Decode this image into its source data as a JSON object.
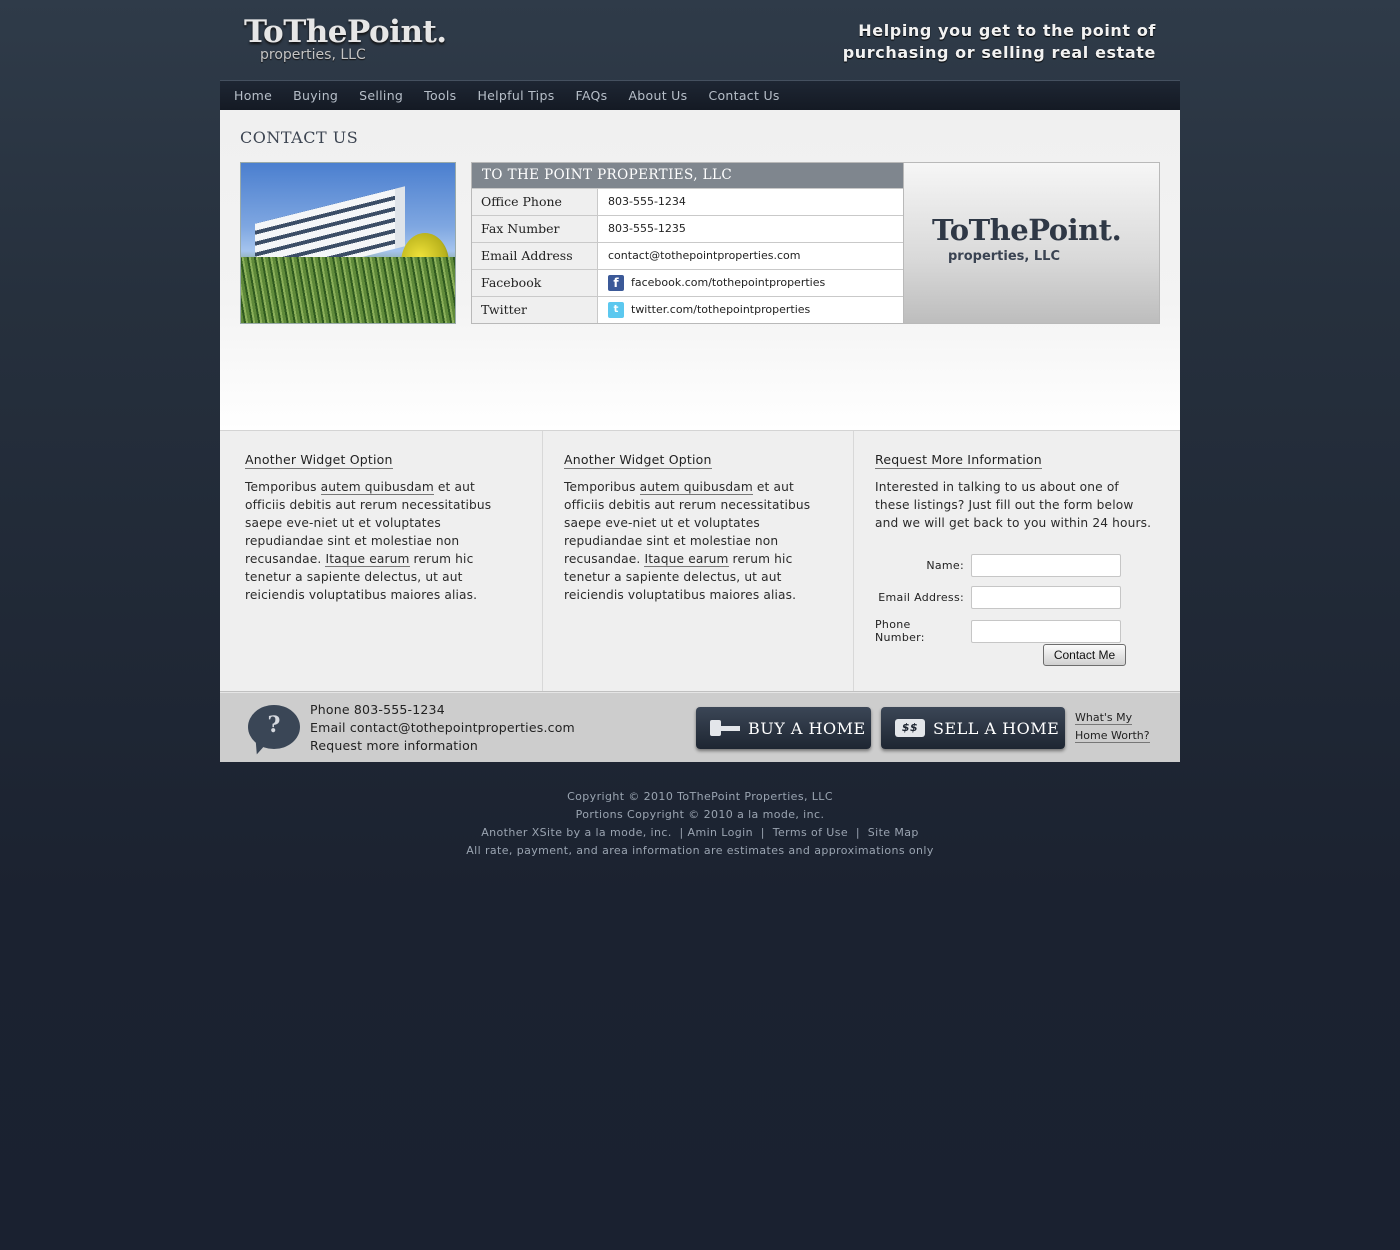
{
  "header": {
    "logo_main": "ToThePoint.",
    "logo_sub": "properties, LLC",
    "tagline_line1": "Helping you get to the point of",
    "tagline_line2": "purchasing or selling real estate"
  },
  "nav": [
    "Home",
    "Buying",
    "Selling",
    "Tools",
    "Helpful Tips",
    "FAQs",
    "About Us",
    "Contact Us"
  ],
  "page": {
    "title": "CONTACT US",
    "info_header": "TO THE POINT PROPERTIES, LLC",
    "rows": [
      {
        "label": "Office Phone",
        "value": "803-555-1234"
      },
      {
        "label": "Fax Number",
        "value": "803-555-1235"
      },
      {
        "label": "Email Address",
        "value": "contact@tothepointproperties.com"
      },
      {
        "label": "Facebook",
        "value": "facebook.com/tothepointproperties",
        "icon": "facebook-icon"
      },
      {
        "label": "Twitter",
        "value": "twitter.com/tothepointproperties",
        "icon": "twitter-icon"
      }
    ],
    "brand_main": "ToThePoint.",
    "brand_sub": "properties, LLC"
  },
  "widgets": {
    "w1": {
      "title": "Another Widget Option",
      "t1": "Temporibus ",
      "link1": "autem quibusdam",
      "t2": " et aut officiis debitis aut rerum necessitatibus saepe eve-niet ut et voluptates repudiandae sint et molestiae non recusandae. ",
      "link2": "Itaque earum",
      "t3": " rerum hic tenetur a sapiente delectus, ut aut reiciendis voluptatibus maiores alias."
    },
    "w2": {
      "title": "Another Widget Option",
      "t1": "Temporibus ",
      "link1": "autem quibusdam",
      "t2": " et aut officiis debitis aut rerum necessitatibus saepe eve-niet ut et voluptates repudiandae sint et molestiae non recusandae. ",
      "link2": "Itaque earum",
      "t3": " rerum hic tenetur a sapiente delectus, ut aut reiciendis voluptatibus maiores alias."
    },
    "form": {
      "title": "Request More Information",
      "intro": "Interested in talking to us about one of these listings? Just fill out the form below and we will get back to you within 24 hours.",
      "name_label": "Name:",
      "email_label": "Email Address:",
      "phone_label": "Phone Number:",
      "submit": "Contact Me"
    }
  },
  "cta": {
    "bubble_glyph": "?",
    "phone": "Phone 803-555-1234",
    "email": "Email contact@tothepointproperties.com",
    "request": "Request more information",
    "buy": "BUY A HOME",
    "sell": "SELL A HOME",
    "sell_icon": "$$",
    "worth_line1": "What's My",
    "worth_line2": "Home Worth?"
  },
  "footer": {
    "line1": "Copyright © 2010 ToThePoint Properties, LLC",
    "line2": "Portions Copyright © 2010 a la mode, inc.",
    "line3_a": "Another XSite by a la mode, inc.",
    "line3_b": "Amin Login",
    "line3_c": "Terms of Use",
    "line3_d": "Site Map",
    "separator": "|",
    "line4": "All rate, payment, and area information are estimates and approximations only"
  }
}
